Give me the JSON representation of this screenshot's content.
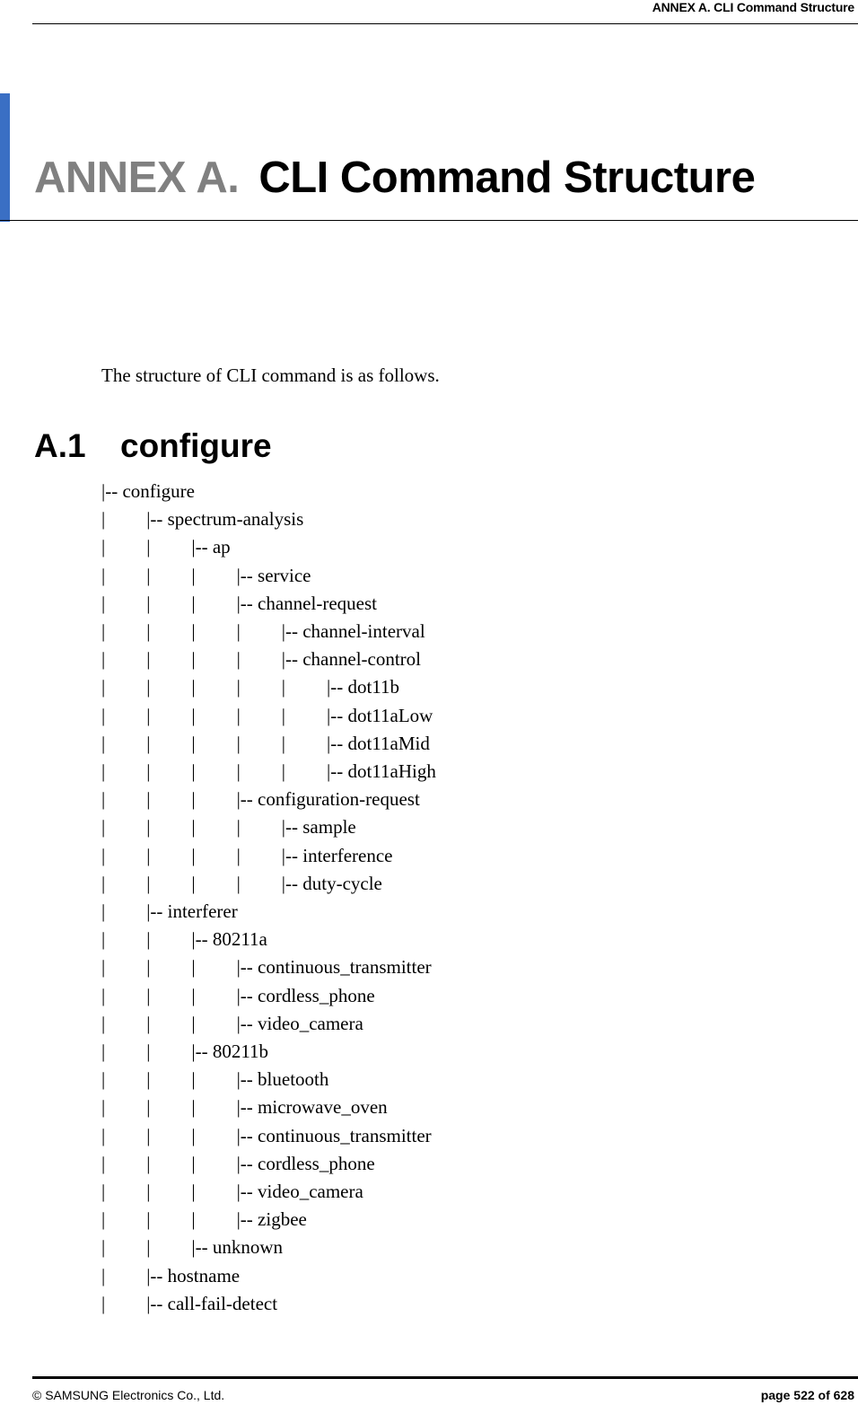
{
  "header": {
    "running_title": "ANNEX A. CLI Command Structure"
  },
  "chapter": {
    "prefix": "ANNEX A.",
    "title": "CLI Command Structure",
    "accent_color": "#3a6fc4"
  },
  "intro": "The structure of CLI command is as follows.",
  "section": {
    "number": "A.1",
    "title": "configure"
  },
  "tree": [
    {
      "depth": 0,
      "label": "configure"
    },
    {
      "depth": 1,
      "label": "spectrum-analysis"
    },
    {
      "depth": 2,
      "label": "ap"
    },
    {
      "depth": 3,
      "label": "service"
    },
    {
      "depth": 3,
      "label": "channel-request"
    },
    {
      "depth": 4,
      "label": "channel-interval"
    },
    {
      "depth": 4,
      "label": "channel-control"
    },
    {
      "depth": 5,
      "label": "dot11b"
    },
    {
      "depth": 5,
      "label": "dot11aLow"
    },
    {
      "depth": 5,
      "label": "dot11aMid"
    },
    {
      "depth": 5,
      "label": "dot11aHigh"
    },
    {
      "depth": 3,
      "label": "configuration-request"
    },
    {
      "depth": 4,
      "label": "sample"
    },
    {
      "depth": 4,
      "label": "interference"
    },
    {
      "depth": 4,
      "label": "duty-cycle"
    },
    {
      "depth": 1,
      "label": "interferer"
    },
    {
      "depth": 2,
      "label": "80211a"
    },
    {
      "depth": 3,
      "label": "continuous_transmitter"
    },
    {
      "depth": 3,
      "label": "cordless_phone"
    },
    {
      "depth": 3,
      "label": "video_camera"
    },
    {
      "depth": 2,
      "label": "80211b"
    },
    {
      "depth": 3,
      "label": "bluetooth"
    },
    {
      "depth": 3,
      "label": "microwave_oven"
    },
    {
      "depth": 3,
      "label": "continuous_transmitter"
    },
    {
      "depth": 3,
      "label": "cordless_phone"
    },
    {
      "depth": 3,
      "label": "video_camera"
    },
    {
      "depth": 3,
      "label": "zigbee"
    },
    {
      "depth": 2,
      "label": "unknown"
    },
    {
      "depth": 1,
      "label": "hostname"
    },
    {
      "depth": 1,
      "label": "call-fail-detect"
    }
  ],
  "footer": {
    "copyright": "© SAMSUNG Electronics Co., Ltd.",
    "page": "page 522 of 628"
  }
}
